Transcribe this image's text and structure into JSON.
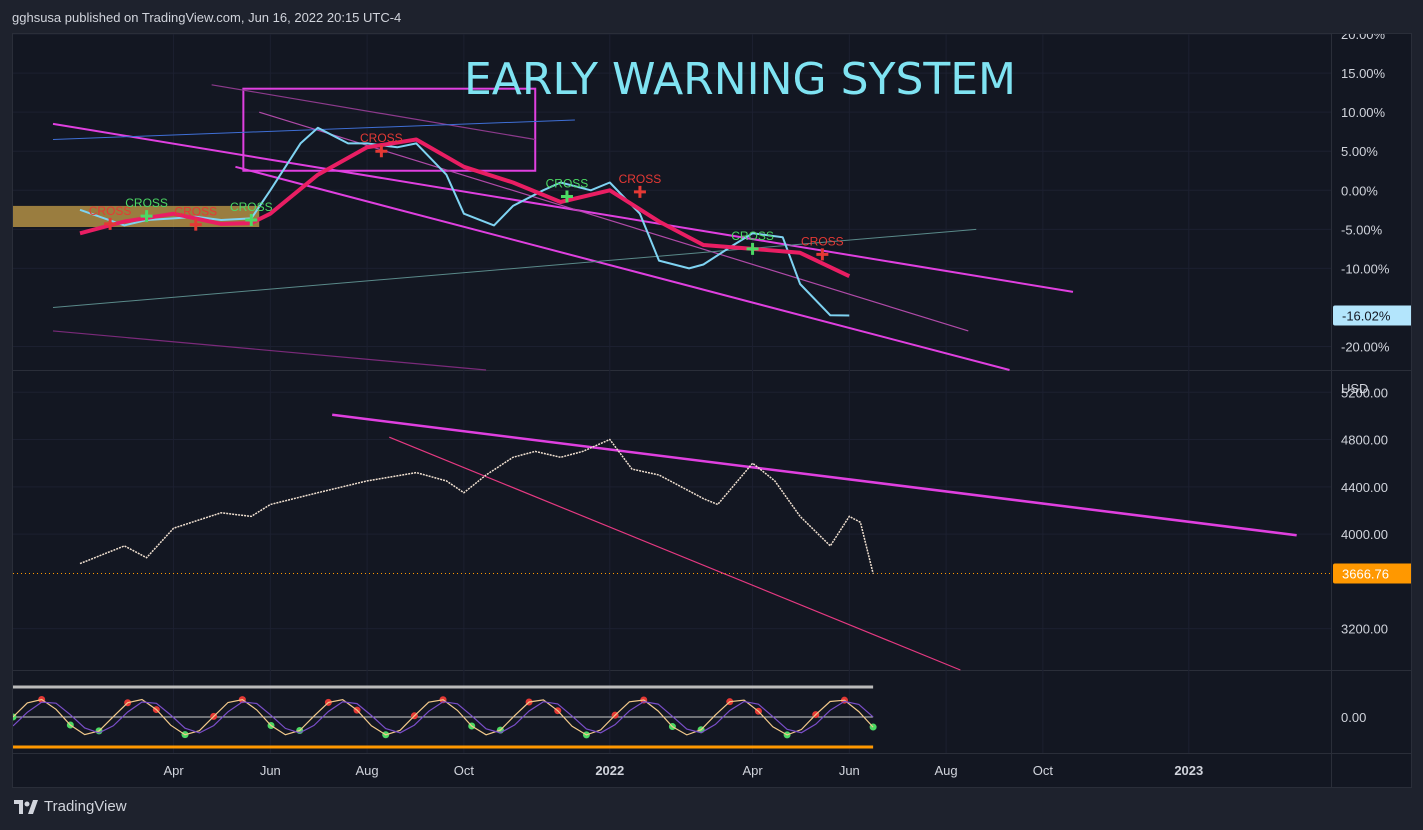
{
  "header": {
    "published_text": "gghsusa published on TradingView.com, Jun 16, 2022 20:15 UTC-4"
  },
  "footer": {
    "brand": "TradingView"
  },
  "colors": {
    "background": "#131722",
    "grid": "#1c2030",
    "trendline": "#e040e0",
    "oscillator_line": "#7fd3f2",
    "signal_line": "#e91e63",
    "cross_up": "#4cd964",
    "cross_down": "#e53935",
    "price": "#ff9800",
    "title": "#7fe3f2"
  },
  "time_axis": {
    "labels": [
      "Apr",
      "Jun",
      "Aug",
      "Oct",
      "2022",
      "Apr",
      "Jun",
      "Aug",
      "Oct",
      "2023"
    ]
  },
  "chart_data": [
    {
      "type": "line",
      "title": "EARLY WARNING SYSTEM",
      "ylabel": "",
      "yticks": [
        "20.00%",
        "15.00%",
        "10.00%",
        "5.00%",
        "0.00%",
        "-5.00%",
        "-10.00%",
        "-20.00%"
      ],
      "ylim": [
        -23,
        20
      ],
      "last_value_label": "-16.02%",
      "series": [
        {
          "x": [
            "2021-02",
            "2021-03",
            "2021-03-15",
            "2021-04",
            "2021-04-15",
            "2021-05",
            "2021-05-20",
            "2021-06",
            "2021-06-20",
            "2021-07",
            "2021-07-20",
            "2021-08",
            "2021-08-20",
            "2021-09",
            "2021-09-20",
            "2021-10",
            "2021-10-20",
            "2021-11",
            "2021-11-20",
            "2021-12",
            "2021-12-20",
            "2022-01",
            "2022-01-20",
            "2022-02",
            "2022-02-20",
            "2022-03",
            "2022-03-20",
            "2022-04",
            "2022-04-20",
            "2022-05",
            "2022-05-20",
            "2022-06"
          ],
          "values": [
            -2.5,
            -4.5,
            -3.8,
            -3.6,
            -3.4,
            -3.8,
            -3.6,
            0,
            6,
            8,
            6,
            6,
            5.5,
            6,
            2,
            -3,
            -4.5,
            -2,
            0,
            1,
            0,
            1,
            -3,
            -9,
            -10,
            -9.5,
            -7,
            -5.5,
            -6,
            -12,
            -16,
            -16.02
          ]
        },
        {
          "x": [
            "2021-02",
            "2021-03",
            "2021-04",
            "2021-05",
            "2021-05-20",
            "2021-06",
            "2021-07",
            "2021-08",
            "2021-09",
            "2021-10",
            "2021-11",
            "2021-12",
            "2022-01",
            "2022-02",
            "2022-03",
            "2022-04",
            "2022-05",
            "2022-06"
          ],
          "values": [
            -5.5,
            -4,
            -3,
            -4.3,
            -4.2,
            -3,
            2,
            5.5,
            6.5,
            3,
            1,
            -1.5,
            0,
            -4,
            -7,
            -7.5,
            -8,
            -11
          ]
        }
      ],
      "annotations": [
        {
          "text": "CROSS",
          "x": "2021-02-20",
          "y": -4.3,
          "dir": "down"
        },
        {
          "text": "CROSS",
          "x": "2021-03-15",
          "y": -3.3,
          "dir": "up"
        },
        {
          "text": "CROSS",
          "x": "2021-04-15",
          "y": -4.4,
          "dir": "down"
        },
        {
          "text": "CROSS",
          "x": "2021-05-20",
          "y": -3.8,
          "dir": "up"
        },
        {
          "text": "CROSS",
          "x": "2021-08-10",
          "y": 5,
          "dir": "down"
        },
        {
          "text": "CROSS",
          "x": "2021-12-05",
          "y": -0.8,
          "dir": "up"
        },
        {
          "text": "CROSS",
          "x": "2022-01-20",
          "y": -0.2,
          "dir": "down"
        },
        {
          "text": "CROSS",
          "x": "2022-04-01",
          "y": -7.5,
          "dir": "up"
        },
        {
          "text": "CROSS",
          "x": "2022-05-15",
          "y": -8.2,
          "dir": "down"
        }
      ]
    },
    {
      "type": "line",
      "ylabel": "USD",
      "yticks": [
        "5200.00",
        "4800.00",
        "4400.00",
        "4000.00",
        "3200.00"
      ],
      "ylim": [
        2850,
        5380
      ],
      "last_value_label": "3666.76",
      "series": [
        {
          "x": [
            "2021-02",
            "2021-03",
            "2021-03-15",
            "2021-04",
            "2021-05",
            "2021-05-20",
            "2021-06",
            "2021-07",
            "2021-08",
            "2021-09",
            "2021-09-20",
            "2021-10",
            "2021-10-15",
            "2021-11",
            "2021-11-15",
            "2021-12",
            "2021-12-15",
            "2022-01",
            "2022-01-15",
            "2022-02",
            "2022-02-15",
            "2022-03",
            "2022-03-10",
            "2022-04",
            "2022-04-15",
            "2022-05",
            "2022-05-20",
            "2022-06",
            "2022-06-08",
            "2022-06-16"
          ],
          "values": [
            3750,
            3900,
            3800,
            4050,
            4180,
            4150,
            4250,
            4350,
            4450,
            4520,
            4450,
            4350,
            4500,
            4650,
            4700,
            4650,
            4700,
            4800,
            4550,
            4500,
            4400,
            4300,
            4250,
            4600,
            4450,
            4150,
            3900,
            4150,
            4100,
            3666.76
          ]
        }
      ]
    },
    {
      "type": "line",
      "yticks": [
        "0.00"
      ]
    }
  ]
}
